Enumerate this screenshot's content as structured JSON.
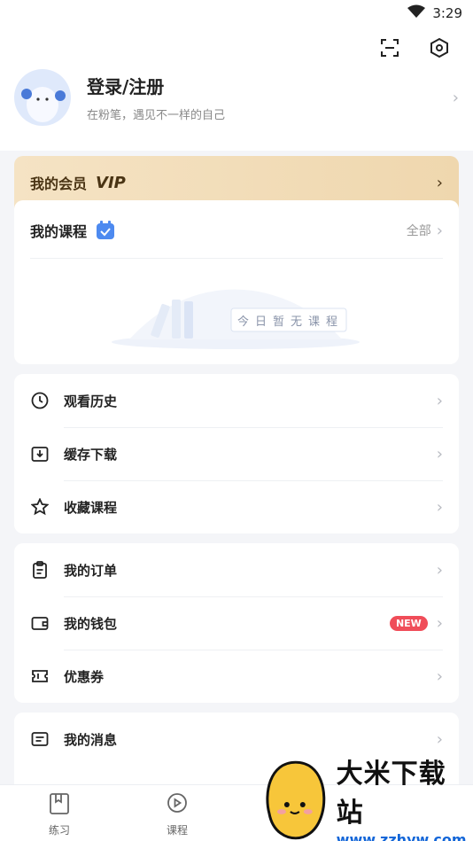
{
  "status": {
    "time": "3:29"
  },
  "profile": {
    "title": "登录/注册",
    "subtitle": "在粉笔，遇见不一样的自己"
  },
  "vip": {
    "label": "我的会员",
    "badge": "VIP"
  },
  "courses": {
    "title": "我的课程",
    "all_label": "全部",
    "empty_text": "今日暂无课程"
  },
  "menu_group1": [
    {
      "label": "观看历史",
      "icon": "clock-icon"
    },
    {
      "label": "缓存下载",
      "icon": "download-icon"
    },
    {
      "label": "收藏课程",
      "icon": "star-icon"
    }
  ],
  "menu_group2": [
    {
      "label": "我的订单",
      "icon": "clipboard-icon"
    },
    {
      "label": "我的钱包",
      "icon": "wallet-icon",
      "badge": "NEW"
    },
    {
      "label": "优惠券",
      "icon": "ticket-icon"
    }
  ],
  "menu_group3": [
    {
      "label": "我的消息",
      "icon": "message-icon"
    }
  ],
  "tabs": [
    {
      "label": "练习",
      "icon": "book-icon"
    },
    {
      "label": "课程",
      "icon": "play-bubble-icon"
    }
  ],
  "watermark": {
    "title": "大米下载站",
    "url": "www.zzhyw.com"
  },
  "colors": {
    "accent": "#3c7df0",
    "badge": "#f04d59",
    "vip_bg": "#f2ddb8"
  }
}
